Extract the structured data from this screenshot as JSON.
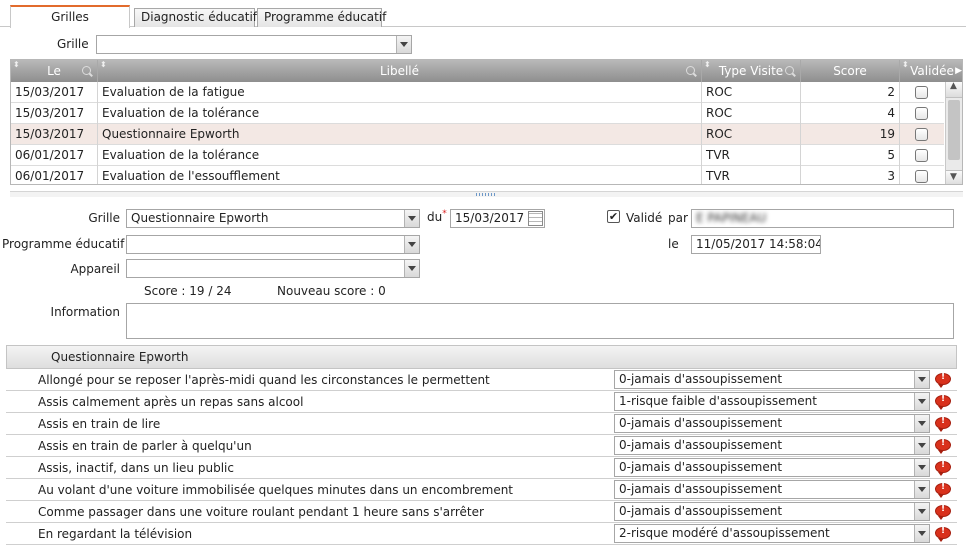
{
  "tabs": [
    {
      "label": "Grilles"
    },
    {
      "label": "Diagnostic éducatif"
    },
    {
      "label": "Programme éducatif"
    }
  ],
  "filter": {
    "grille_label": "Grille",
    "grille_value": ""
  },
  "grid": {
    "columns": [
      "Le",
      "Libellé",
      "Type Visite",
      "Score",
      "Validée"
    ],
    "rows": [
      {
        "date": "15/03/2017",
        "libelle": "Evaluation de la fatigue",
        "type": "ROC",
        "score": "2",
        "validee": false
      },
      {
        "date": "15/03/2017",
        "libelle": "Evaluation de la tolérance",
        "type": "ROC",
        "score": "4",
        "validee": false
      },
      {
        "date": "15/03/2017",
        "libelle": "Questionnaire Epworth",
        "type": "ROC",
        "score": "19",
        "validee": false
      },
      {
        "date": "06/01/2017",
        "libelle": "Evaluation de la tolérance",
        "type": "TVR",
        "score": "5",
        "validee": false
      },
      {
        "date": "06/01/2017",
        "libelle": "Evaluation de l'essoufflement",
        "type": "TVR",
        "score": "3",
        "validee": false
      }
    ]
  },
  "form": {
    "grille_label": "Grille",
    "grille_value": "Questionnaire Epworth",
    "du_label": "du",
    "required_mark": "*",
    "du_value": "15/03/2017",
    "valide_label": "Validé",
    "par_label": "par",
    "par_value": "E          PAPINEAU",
    "programme_label": "Programme éducatif",
    "programme_value": "",
    "le_label": "le",
    "le_value": "11/05/2017 14:58:04",
    "appareil_label": "Appareil",
    "appareil_value": "",
    "score_text": "Score : 19 / 24",
    "nouveau_score_text": "Nouveau score  : 0",
    "information_label": "Information",
    "information_value": ""
  },
  "questionnaire": {
    "title": "Questionnaire Epworth",
    "items": [
      {
        "question": "Allongé pour se reposer l'après-midi quand les circonstances le permettent",
        "answer": "0-jamais d'assoupissement"
      },
      {
        "question": "Assis calmement après un repas sans alcool",
        "answer": "1-risque faible d'assoupissement"
      },
      {
        "question": "Assis en train de lire",
        "answer": "0-jamais d'assoupissement"
      },
      {
        "question": "Assis en train de parler à quelqu'un",
        "answer": "0-jamais d'assoupissement"
      },
      {
        "question": "Assis, inactif, dans un lieu public",
        "answer": "0-jamais d'assoupissement"
      },
      {
        "question": "Au volant d'une voiture immobilisée quelques minutes dans un encombrement",
        "answer": "0-jamais d'assoupissement"
      },
      {
        "question": "Comme passager dans une voiture roulant pendant 1 heure sans s'arrêter",
        "answer": "0-jamais d'assoupissement"
      },
      {
        "question": "En regardant la télévision",
        "answer": "2-risque modéré d'assoupissement"
      }
    ]
  }
}
